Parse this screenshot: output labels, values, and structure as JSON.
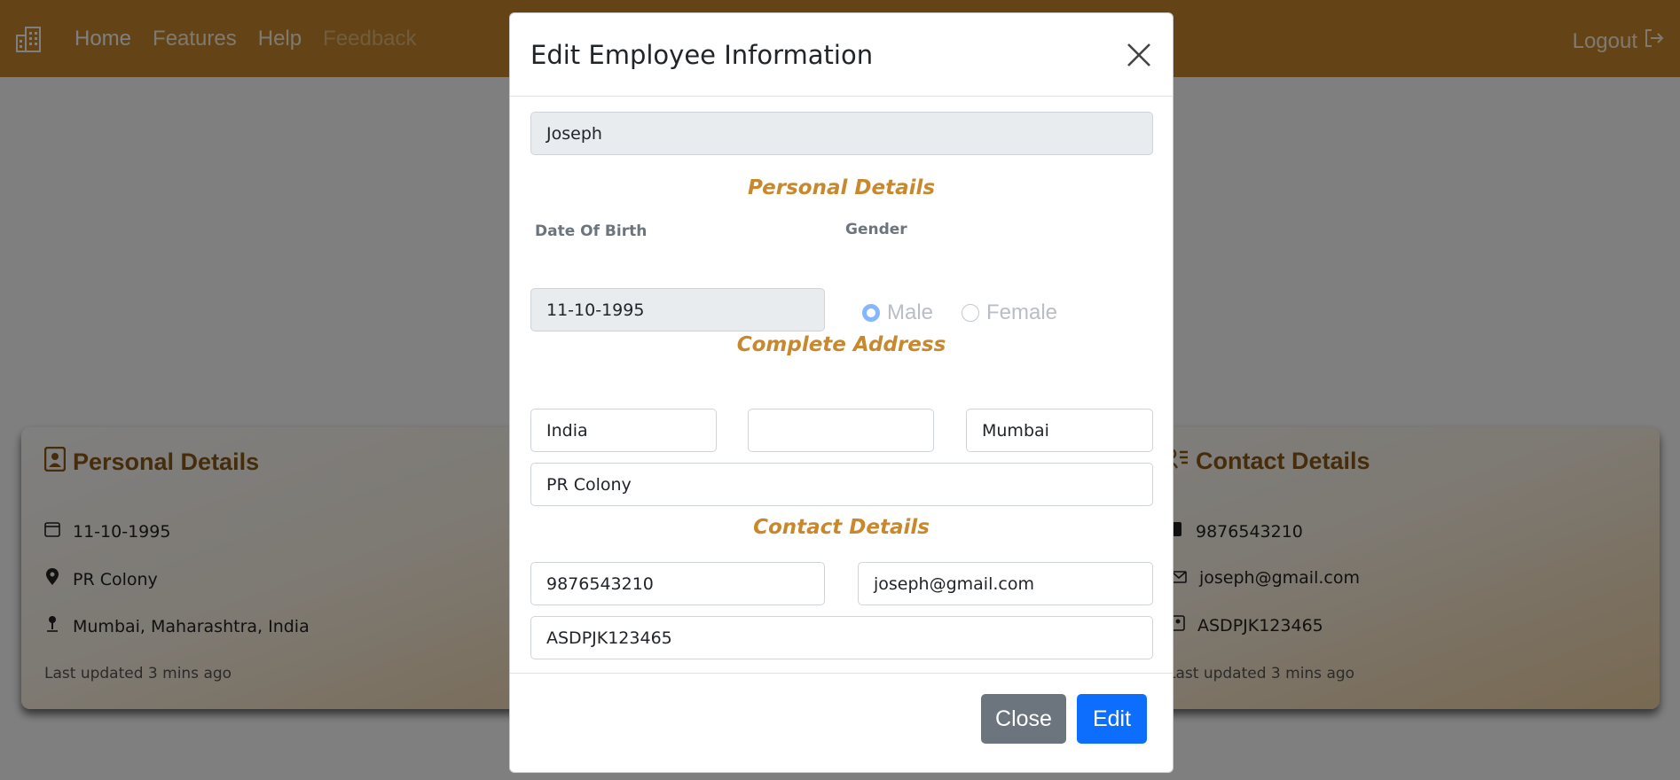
{
  "navbar": {
    "logo_icon": "building-icon",
    "links": [
      {
        "label": "Home"
      },
      {
        "label": "Features"
      },
      {
        "label": "Help"
      },
      {
        "label": "Feedback"
      }
    ],
    "logout_label": "Logout",
    "logout_icon": "logout-icon",
    "background_color": "#c8892e"
  },
  "cards": {
    "personal": {
      "title": "Personal Details",
      "icon": "person-badge-icon",
      "rows": [
        {
          "icon": "calendar-icon",
          "text": "11-10-1995"
        },
        {
          "icon": "location-pin-icon",
          "text": "PR Colony"
        },
        {
          "icon": "map-pin-icon",
          "text": "Mumbai, Maharashtra, India"
        }
      ],
      "updated": "Last updated 3 mins ago"
    },
    "contact": {
      "title": "Contact Details",
      "icon": "person-lines-icon",
      "rows": [
        {
          "icon": "phone-icon",
          "text": "9876543210"
        },
        {
          "icon": "envelope-icon",
          "text": "joseph@gmail.com"
        },
        {
          "icon": "id-card-icon",
          "text": "ASDPJK123465"
        }
      ],
      "updated": "Last updated 3 mins ago"
    }
  },
  "modal": {
    "title": "Edit Employee Information",
    "name_value": "Joseph",
    "personal_heading": "Personal Details",
    "dob_label": "Date Of Birth",
    "dob_value": "11-10-1995",
    "gender_label": "Gender",
    "gender_options": [
      {
        "label": "Male",
        "checked": true
      },
      {
        "label": "Female",
        "checked": false
      }
    ],
    "address_heading": "Complete Address",
    "country_value": "India",
    "state_value": "",
    "city_value": "Mumbai",
    "street_value": "PR Colony",
    "contact_heading": "Contact Details",
    "phone_value": "9876543210",
    "email_value": "joseph@gmail.com",
    "id_value": "ASDPJK123465",
    "close_label": "Close",
    "edit_label": "Edit"
  },
  "colors": {
    "accent": "#c8892e",
    "primary_button": "#0d6efd",
    "secondary_button": "#6c757d",
    "heading_brown": "#8a5a17"
  }
}
